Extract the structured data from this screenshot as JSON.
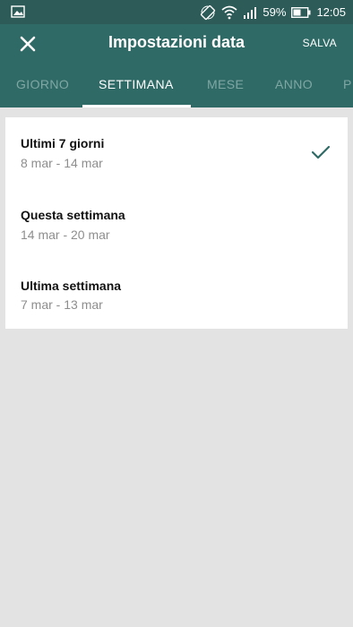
{
  "status": {
    "battery_text": "59%",
    "time": "12:05"
  },
  "appbar": {
    "title": "Impostazioni data",
    "save_label": "SALVA"
  },
  "tabs": [
    {
      "label": "GIORNO"
    },
    {
      "label": "SETTIMANA"
    },
    {
      "label": "MESE"
    },
    {
      "label": "ANNO"
    },
    {
      "label": "P"
    }
  ],
  "options": [
    {
      "title": "Ultimi 7 giorni",
      "range": "8 mar - 14 mar",
      "selected": true
    },
    {
      "title": "Questa settimana",
      "range": "14 mar - 20 mar",
      "selected": false
    },
    {
      "title": "Ultima settimana",
      "range": "7 mar - 13 mar",
      "selected": false
    }
  ],
  "colors": {
    "primary": "#2f6a66",
    "status_bar": "#2c5b58",
    "inactive_tab": "#7fa7a4",
    "background": "#e3e3e3"
  }
}
